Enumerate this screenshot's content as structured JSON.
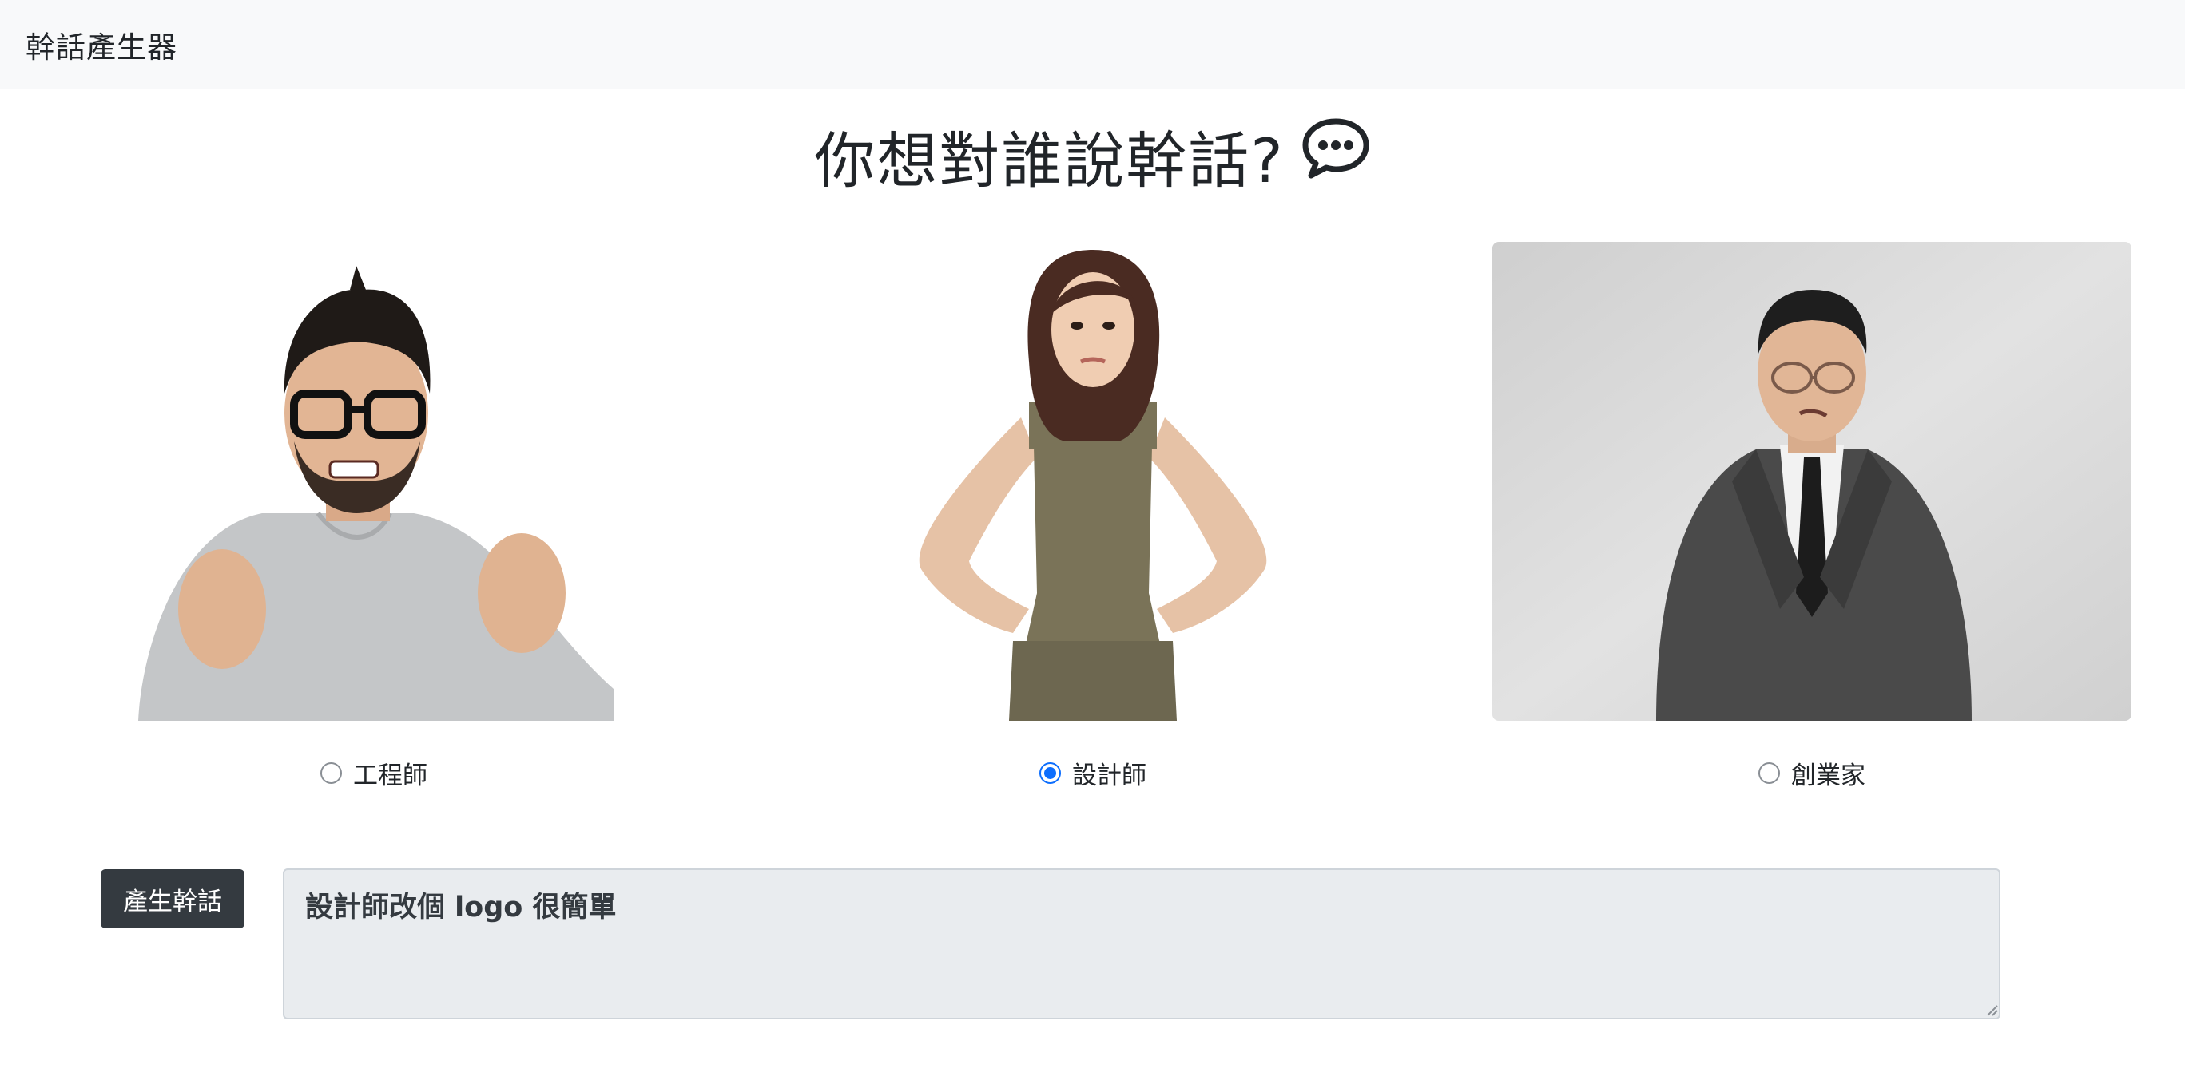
{
  "navbar": {
    "brand": "幹話產生器"
  },
  "heading": {
    "text": "你想對誰說幹話?",
    "icon": "chat-dots-icon"
  },
  "choices": [
    {
      "label": "工程師",
      "checked": false,
      "image": "frustrated-engineer-photo"
    },
    {
      "label": "設計師",
      "checked": true,
      "image": "annoyed-designer-photo"
    },
    {
      "label": "創業家",
      "checked": false,
      "image": "skeptical-entrepreneur-photo"
    }
  ],
  "generate": {
    "label": "產生幹話"
  },
  "output": {
    "value": "設計師改個 logo 很簡單"
  },
  "colors": {
    "accent": "#0d6efd",
    "button_bg": "#343a40",
    "navbar_bg": "#f8f9fa"
  }
}
